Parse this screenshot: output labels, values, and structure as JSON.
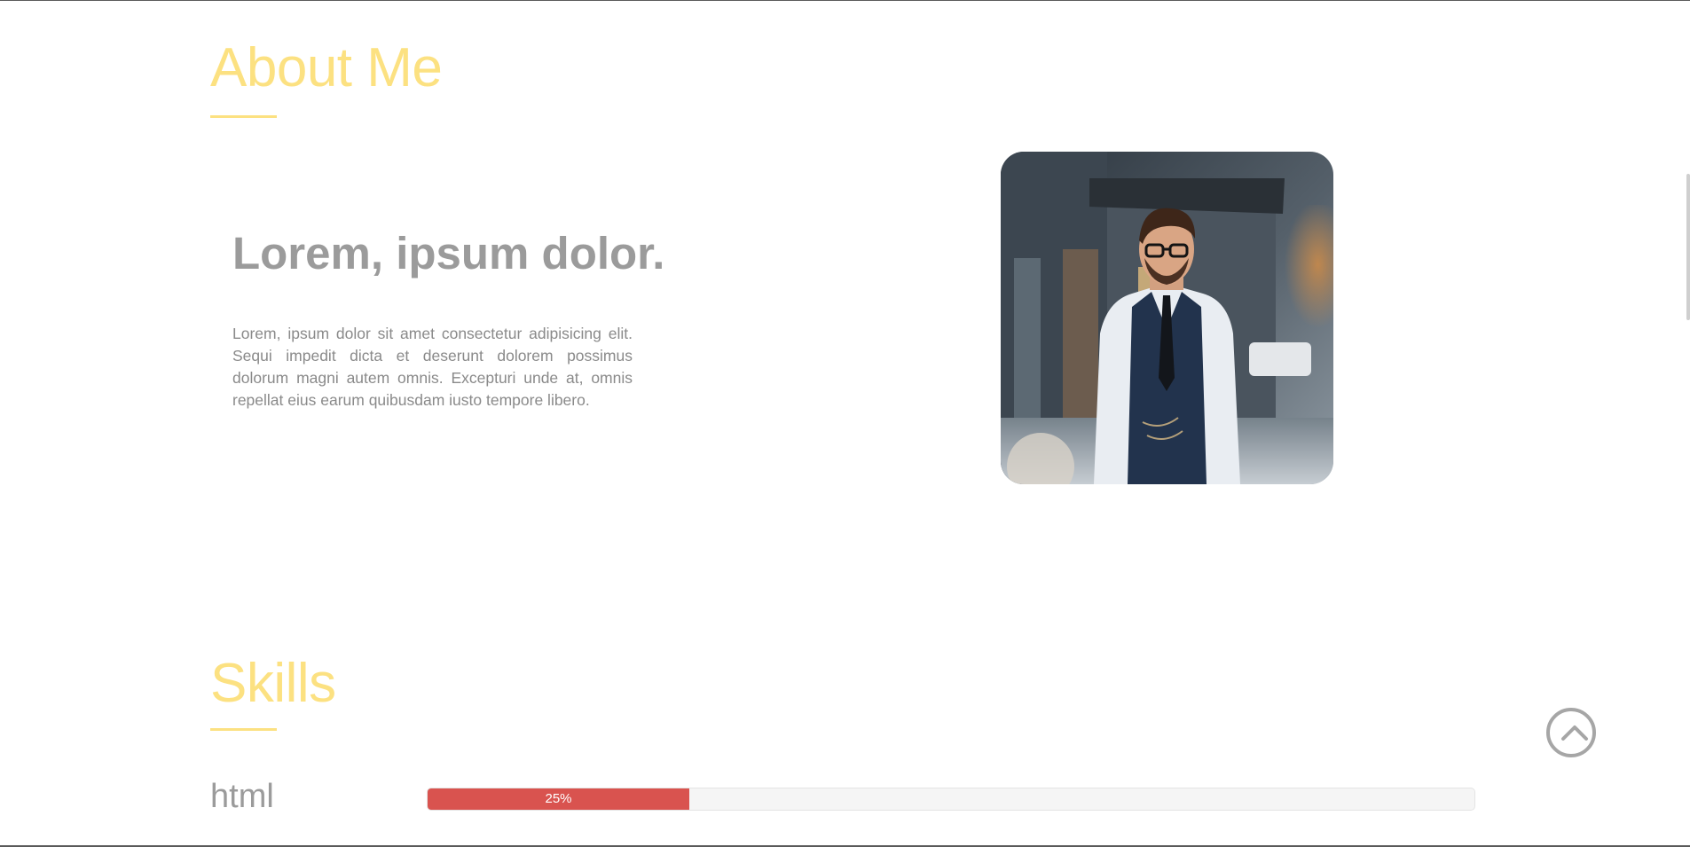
{
  "about": {
    "title": "About Me",
    "heading": "Lorem, ipsum dolor.",
    "text": "Lorem, ipsum dolor sit amet consectetur adipisicing elit. Sequi impedit dicta et deserunt dolorem possimus dolorum magni autem omnis. Excepturi unde at, omnis repellat eius earum quibusdam iusto tempore libero."
  },
  "skills": {
    "title": "Skills",
    "items": [
      {
        "label": "html",
        "percent": 25,
        "percent_label": "25%"
      }
    ]
  },
  "icons": {
    "scroll_top": "chevron-up-icon",
    "portrait": "portrait-photo"
  },
  "colors": {
    "accent": "#fce181",
    "heading_gray": "#9b9b9b",
    "text_gray": "#8a8a8a",
    "progress_fill": "#d9534f",
    "button_border": "#a6a6a6"
  }
}
